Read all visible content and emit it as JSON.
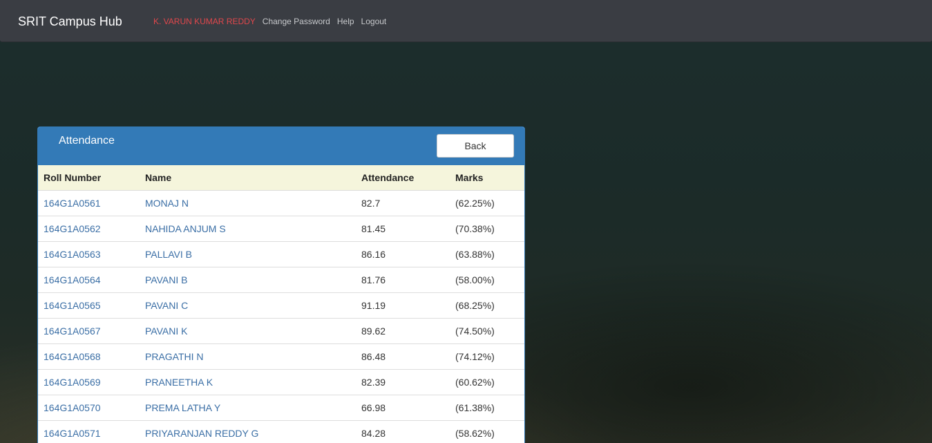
{
  "navbar": {
    "brand": "SRIT Campus Hub",
    "user_name": "K. VARUN KUMAR REDDY",
    "links": [
      "Change Password",
      "Help",
      "Logout"
    ],
    "user_color": "#e0474c"
  },
  "panel": {
    "title": "Attendance",
    "back_label": "Back",
    "accent": "#337ab7"
  },
  "table": {
    "headers": [
      "Roll Number",
      "Name",
      "Attendance",
      "Marks"
    ],
    "rows": [
      {
        "roll": "164G1A0561",
        "name": "MONAJ N",
        "attendance": "82.7",
        "marks": "(62.25%)"
      },
      {
        "roll": "164G1A0562",
        "name": "NAHIDA ANJUM S",
        "attendance": "81.45",
        "marks": "(70.38%)"
      },
      {
        "roll": "164G1A0563",
        "name": "PALLAVI B",
        "attendance": "86.16",
        "marks": "(63.88%)"
      },
      {
        "roll": "164G1A0564",
        "name": "PAVANI B",
        "attendance": "81.76",
        "marks": "(58.00%)"
      },
      {
        "roll": "164G1A0565",
        "name": "PAVANI C",
        "attendance": "91.19",
        "marks": "(68.25%)"
      },
      {
        "roll": "164G1A0567",
        "name": "PAVANI K",
        "attendance": "89.62",
        "marks": "(74.50%)"
      },
      {
        "roll": "164G1A0568",
        "name": "PRAGATHI N",
        "attendance": "86.48",
        "marks": "(74.12%)"
      },
      {
        "roll": "164G1A0569",
        "name": "PRANEETHA K",
        "attendance": "82.39",
        "marks": "(60.62%)"
      },
      {
        "roll": "164G1A0570",
        "name": "PREMA LATHA Y",
        "attendance": "66.98",
        "marks": "(61.38%)"
      },
      {
        "roll": "164G1A0571",
        "name": "PRIYARANJAN REDDY G",
        "attendance": "84.28",
        "marks": "(58.62%)"
      }
    ]
  }
}
